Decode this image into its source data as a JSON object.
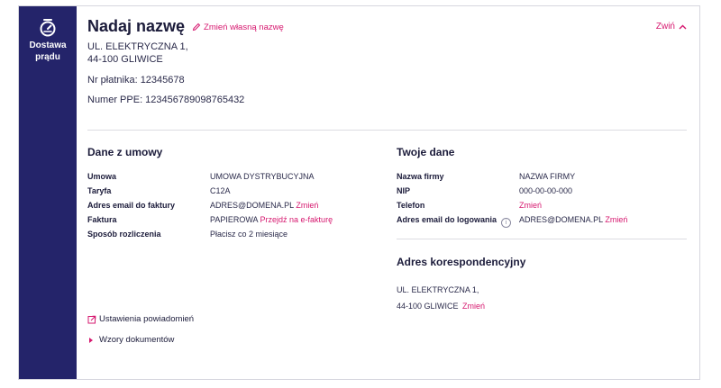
{
  "sidebar": {
    "icon": "power-meter-icon",
    "label": "Dostawa\nprądu"
  },
  "header": {
    "title": "Nadaj nazwę",
    "rename_link": "Zmień własną nazwę",
    "collapse_label": "Zwiń",
    "address": "UL. ELEKTRYCZNA 1,\n44-100 GLIWICE",
    "payer_number": "Nr płatnika: 12345678",
    "ppe_number": "Numer PPE: 123456789098765432"
  },
  "contract": {
    "title": "Dane z umowy",
    "rows": [
      {
        "key": "Umowa",
        "value": "UMOWA DYSTRYBUCYJNA",
        "link": ""
      },
      {
        "key": "Taryfa",
        "value": "C12A",
        "link": ""
      },
      {
        "key": "Adres email do faktury",
        "value": "ADRES@DOMENA.PL",
        "link": "Zmień"
      },
      {
        "key": "Faktura",
        "value": "PAPIEROWA",
        "link": "Przejdź na e-fakturę"
      },
      {
        "key": "Sposób rozliczenia",
        "value": "Płacisz co 2 miesiące",
        "link": ""
      }
    ]
  },
  "your_data": {
    "title": "Twoje dane",
    "rows": [
      {
        "key": "Nazwa firmy",
        "value": "NAZWA FIRMY",
        "link": ""
      },
      {
        "key": "NIP",
        "value": "000-00-00-000",
        "link": ""
      },
      {
        "key": "Telefon",
        "value": "",
        "link": "Zmień"
      },
      {
        "key": "Adres email do logowania",
        "value": "ADRES@DOMENA.PL",
        "link": "Zmień"
      }
    ],
    "info_icon": "i"
  },
  "correspondence": {
    "title": "Adres korespondencyjny",
    "address": "UL. ELEKTRYCZNA 1,\n44-100 GLIWICE",
    "link": "Zmień"
  },
  "footer": {
    "notifications_link": "Ustawienia powiadomień",
    "documents_link": "Wzory dokumentów"
  },
  "colors": {
    "sidebar": "#24246a",
    "accent": "#d6186f",
    "text": "#1b1b3a"
  }
}
